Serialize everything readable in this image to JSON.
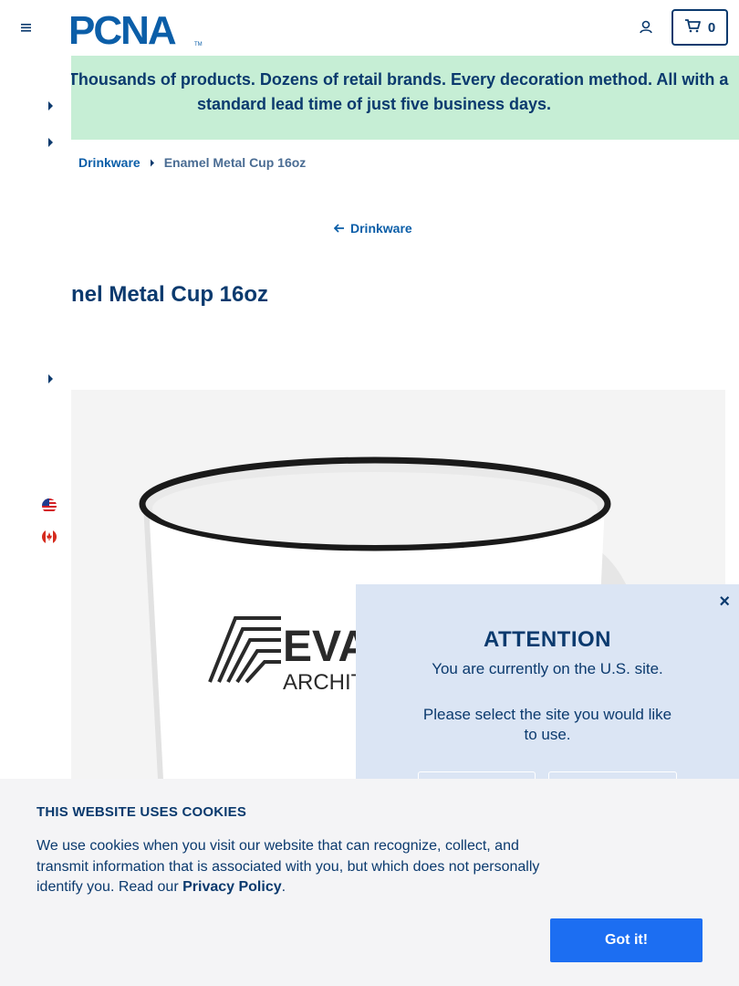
{
  "header": {
    "logo_text": "PCNA",
    "cart_count": "0"
  },
  "promo": {
    "text": "Wait? Thousands of products. Dozens of retail brands. Every decoration method. All with a standard lead time of just five business days."
  },
  "breadcrumb": {
    "items": [
      {
        "label": "Drinkware"
      },
      {
        "label": "Enamel Metal Cup 16oz"
      }
    ]
  },
  "back_link": {
    "label": "Drinkware"
  },
  "product": {
    "title": "nel Metal Cup 16oz",
    "imprint_text": "EVA",
    "imprint_sub": "ARCHITECT"
  },
  "attention": {
    "close": "×",
    "title": "ATTENTION",
    "line1": "You are currently on the U.S. site.",
    "line2": "Please select the site you would like to use."
  },
  "cookies": {
    "title": "THIS WEBSITE USES COOKIES",
    "body": "We use cookies when you visit our website that can recognize, collect, and transmit information that is associated with you, but which does not personally identify you. Read our ",
    "policy": "Privacy Policy",
    "period": ".",
    "button": "Got it!"
  },
  "colors": {
    "brand_navy": "#0b3a6e",
    "link_blue": "#0b5ea8",
    "promo_green": "#c6eed5",
    "modal_bg": "#dbe5f4",
    "button_blue": "#1c6ef2"
  }
}
